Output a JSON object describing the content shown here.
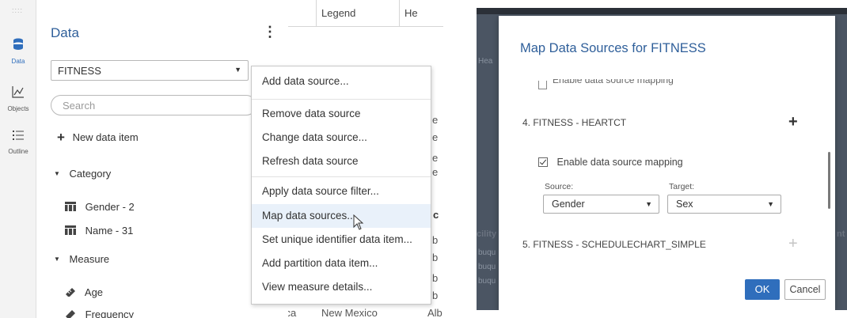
{
  "rail": {
    "grip": "::::",
    "data": "Data",
    "objects": "Objects",
    "outline": "Outline"
  },
  "datapane": {
    "title": "Data",
    "kebab": "⋮",
    "selected_source": "FITNESS",
    "search_placeholder": "Search",
    "new_item": "New data item",
    "category": "Category",
    "category_items": [
      "Gender - 2",
      "Name - 31"
    ],
    "measure": "Measure",
    "measure_items": [
      "Age",
      "Frequency"
    ]
  },
  "bgtable": {
    "headers": [
      ")",
      "Legend",
      "He"
    ],
    "cells": [
      "e",
      "e",
      "e",
      "e",
      "c",
      "b",
      "b",
      "b",
      "b",
      "erica",
      "New Mexico",
      "Alb"
    ]
  },
  "context_menu": {
    "items": [
      "Add data source...",
      "Remove data source",
      "Change data source...",
      "Refresh data source",
      "Apply data source filter...",
      "Map data sources...",
      "Set unique identifier data item...",
      "Add partition data item...",
      "View measure details..."
    ],
    "highlighted_index": 5
  },
  "dialog": {
    "title": "Map Data Sources for FITNESS",
    "cut_text": "Enable data source mapping",
    "section_4": "4. FITNESS - HEARTCT",
    "enable_mapping": "Enable data source mapping",
    "source_label": "Source:",
    "target_label": "Target:",
    "source_value": "Gender",
    "target_value": "Sex",
    "section_5": "5. FITNESS - SCHEDULECHART_SIMPLE",
    "ok": "OK",
    "cancel": "Cancel"
  },
  "right_bg": {
    "ghost_1": "Hea",
    "ghost_2": "cility",
    "ghost_3": "buqu",
    "ghost_4": "buqu",
    "ghost_5": "buqu",
    "ghost_6": "nt"
  },
  "colors": {
    "accent": "#2f6ebc",
    "title_blue": "#2f5f9a",
    "menu_highlight": "#e9f1fa",
    "overlay": "#4b5563"
  }
}
